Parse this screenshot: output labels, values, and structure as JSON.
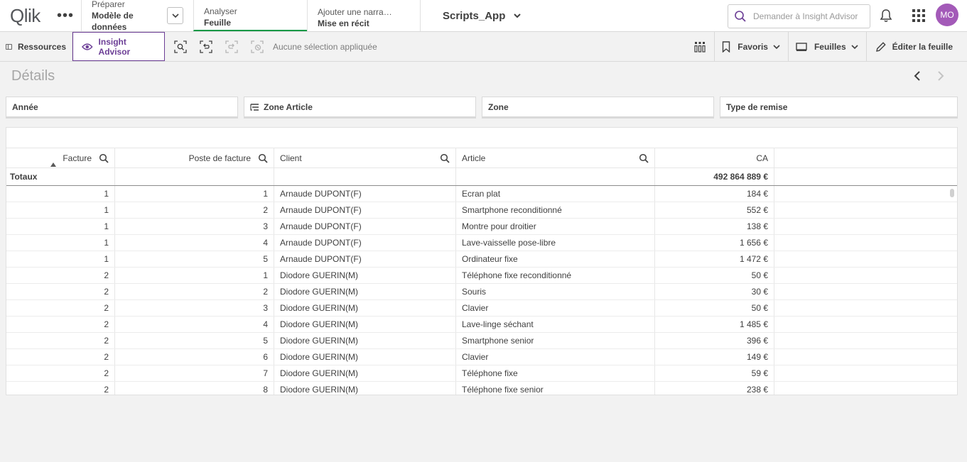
{
  "topbar": {
    "logo": "Qlik",
    "prepare_small": "Préparer",
    "prepare_big": "Modèle de données",
    "analyze_small": "Analyser",
    "analyze_big": "Feuille",
    "narrate_small": "Ajouter une narra…",
    "narrate_big": "Mise en récit",
    "app_name": "Scripts_App",
    "search_placeholder": "Demander à Insight Advisor",
    "avatar_initials": "MO",
    "accent_color": "#009845",
    "avatar_color": "#a35ab8"
  },
  "toolbar": {
    "resources_label": "Ressources",
    "insight_label": "Insight Advisor",
    "no_selection": "Aucune sélection appliquée",
    "favorites_label": "Favoris",
    "sheets_label": "Feuilles",
    "edit_label": "Éditer la feuille",
    "insight_color": "#6c3e96"
  },
  "sheet": {
    "title": "Détails"
  },
  "filters": [
    "Année",
    "Zone Article",
    "Zone",
    "Type de remise"
  ],
  "table": {
    "columns": [
      "Facture",
      "Poste de facture",
      "Client",
      "Article",
      "CA"
    ],
    "totals_label": "Totaux",
    "totals_ca": "492 864 889 €",
    "rows": [
      {
        "facture": "1",
        "poste": "1",
        "client": "Arnaude DUPONT(F)",
        "article": "Ecran plat",
        "ca": "184 €"
      },
      {
        "facture": "1",
        "poste": "2",
        "client": "Arnaude DUPONT(F)",
        "article": "Smartphone reconditionné",
        "ca": "552 €"
      },
      {
        "facture": "1",
        "poste": "3",
        "client": "Arnaude DUPONT(F)",
        "article": "Montre pour droitier",
        "ca": "138 €"
      },
      {
        "facture": "1",
        "poste": "4",
        "client": "Arnaude DUPONT(F)",
        "article": "Lave-vaisselle pose-libre",
        "ca": "1 656 €"
      },
      {
        "facture": "1",
        "poste": "5",
        "client": "Arnaude DUPONT(F)",
        "article": "Ordinateur fixe",
        "ca": "1 472 €"
      },
      {
        "facture": "2",
        "poste": "1",
        "client": "Diodore GUERIN(M)",
        "article": "Téléphone fixe reconditionné",
        "ca": "50 €"
      },
      {
        "facture": "2",
        "poste": "2",
        "client": "Diodore GUERIN(M)",
        "article": "Souris",
        "ca": "30 €"
      },
      {
        "facture": "2",
        "poste": "3",
        "client": "Diodore GUERIN(M)",
        "article": "Clavier",
        "ca": "50 €"
      },
      {
        "facture": "2",
        "poste": "4",
        "client": "Diodore GUERIN(M)",
        "article": "Lave-linge séchant",
        "ca": "1 485 €"
      },
      {
        "facture": "2",
        "poste": "5",
        "client": "Diodore GUERIN(M)",
        "article": "Smartphone senior",
        "ca": "396 €"
      },
      {
        "facture": "2",
        "poste": "6",
        "client": "Diodore GUERIN(M)",
        "article": "Clavier",
        "ca": "149 €"
      },
      {
        "facture": "2",
        "poste": "7",
        "client": "Diodore GUERIN(M)",
        "article": "Téléphone fixe",
        "ca": "59 €"
      },
      {
        "facture": "2",
        "poste": "8",
        "client": "Diodore GUERIN(M)",
        "article": "Téléphone fixe senior",
        "ca": "238 €"
      }
    ]
  }
}
